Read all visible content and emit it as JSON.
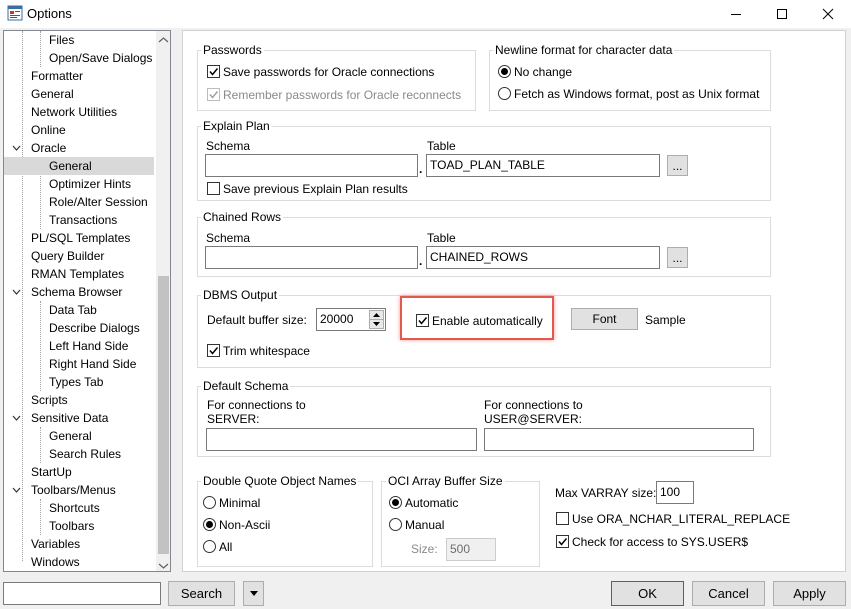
{
  "window": {
    "title": "Options"
  },
  "tree": {
    "items": [
      {
        "label": "Files"
      },
      {
        "label": "Open/Save Dialogs"
      },
      {
        "label": "Formatter"
      },
      {
        "label": "General"
      },
      {
        "label": "Network Utilities"
      },
      {
        "label": "Online"
      },
      {
        "label": "Oracle"
      },
      {
        "label": "General"
      },
      {
        "label": "Optimizer Hints"
      },
      {
        "label": "Role/Alter Session"
      },
      {
        "label": "Transactions"
      },
      {
        "label": "PL/SQL Templates"
      },
      {
        "label": "Query Builder"
      },
      {
        "label": "RMAN Templates"
      },
      {
        "label": "Schema Browser"
      },
      {
        "label": "Data Tab"
      },
      {
        "label": "Describe Dialogs"
      },
      {
        "label": "Left Hand Side"
      },
      {
        "label": "Right Hand Side"
      },
      {
        "label": "Types Tab"
      },
      {
        "label": "Scripts"
      },
      {
        "label": "Sensitive Data"
      },
      {
        "label": "General"
      },
      {
        "label": "Search Rules"
      },
      {
        "label": "StartUp"
      },
      {
        "label": "Toolbars/Menus"
      },
      {
        "label": "Shortcuts"
      },
      {
        "label": "Toolbars"
      },
      {
        "label": "Variables"
      },
      {
        "label": "Windows"
      }
    ]
  },
  "passwords": {
    "legend": "Passwords",
    "save_label": "Save passwords for Oracle connections",
    "remember_label": "Remember passwords for Oracle reconnects"
  },
  "newline": {
    "legend": "Newline format for character data",
    "no_change": "No change",
    "fetch_windows": "Fetch as Windows format, post as Unix format"
  },
  "explain_plan": {
    "legend": "Explain Plan",
    "schema_label": "Schema",
    "table_label": "Table",
    "schema_value": "",
    "table_value": "TOAD_PLAN_TABLE",
    "browse_label": "...",
    "dot": ".",
    "save_prev_label": "Save previous Explain Plan results"
  },
  "chained_rows": {
    "legend": "Chained Rows",
    "schema_label": "Schema",
    "table_label": "Table",
    "schema_value": "",
    "table_value": "CHAINED_ROWS",
    "browse_label": "...",
    "dot": "."
  },
  "dbms_output": {
    "legend": "DBMS Output",
    "buffer_label": "Default buffer size:",
    "buffer_value": "20000",
    "enable_label": "Enable automatically",
    "font_button": "Font",
    "sample_label": "Sample",
    "trim_label": "Trim whitespace"
  },
  "default_schema": {
    "legend": "Default Schema",
    "server_label_1": "For connections to",
    "server_label_2": "SERVER:",
    "user_label_1": "For connections to",
    "user_label_2": "USER@SERVER:",
    "server_value": "",
    "user_value": ""
  },
  "double_quote": {
    "legend": "Double Quote Object Names",
    "minimal": "Minimal",
    "non_ascii": "Non-Ascii",
    "all": "All"
  },
  "oci_array": {
    "legend": "OCI Array Buffer Size",
    "automatic": "Automatic",
    "manual": "Manual",
    "size_label": "Size:",
    "size_value": "500"
  },
  "varray": {
    "label": "Max VARRAY size:",
    "value": "100",
    "nchar_label": "Use ORA_NCHAR_LITERAL_REPLACE",
    "sysuser_label": "Check for access to SYS.USER$"
  },
  "footer": {
    "search_value": "",
    "search_button": "Search",
    "ok_button": "OK",
    "cancel_button": "Cancel",
    "apply_button": "Apply"
  },
  "colors": {
    "selected_row": "#d9d9d9",
    "highlight_border": "#e15a4f"
  }
}
